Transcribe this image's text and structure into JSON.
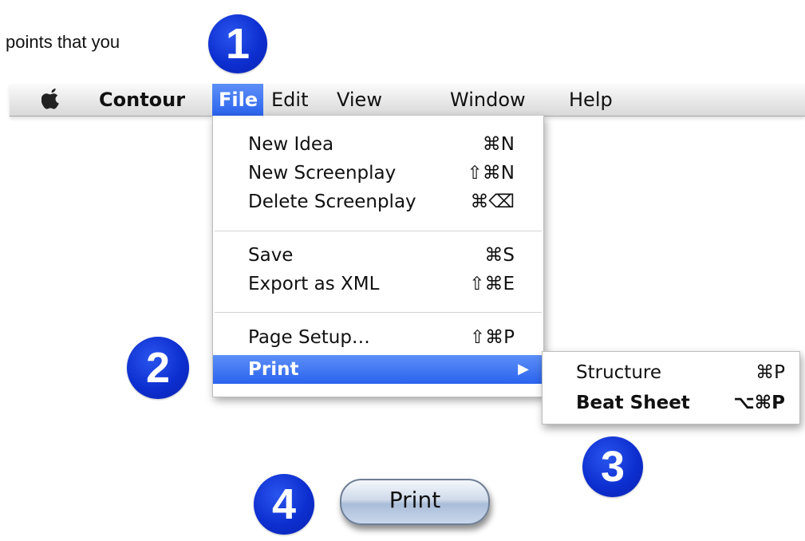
{
  "intro": {
    "text": "points that you"
  },
  "callouts": [
    "1",
    "2",
    "3",
    "4"
  ],
  "menubar": {
    "app": "Contour",
    "items": [
      {
        "label": "File",
        "active": true
      },
      {
        "label": "Edit"
      },
      {
        "label": "View"
      },
      {
        "label": "Window"
      },
      {
        "label": "Help"
      }
    ]
  },
  "file_menu": {
    "items": [
      {
        "label": "New Idea",
        "shortcut": "⌘N"
      },
      {
        "label": "New Screenplay",
        "shortcut": "⇧⌘N"
      },
      {
        "label": "Delete Screenplay",
        "shortcut": "⌘⌫"
      },
      {
        "label": "Save",
        "shortcut": "⌘S"
      },
      {
        "label": "Export as XML",
        "shortcut": "⇧⌘E"
      },
      {
        "label": "Page Setup…",
        "shortcut": "⇧⌘P"
      },
      {
        "label": "Print",
        "shortcut": "▶",
        "highlighted": true
      }
    ]
  },
  "print_submenu": {
    "items": [
      {
        "label": "Structure",
        "shortcut": "⌘P"
      },
      {
        "label": "Beat Sheet",
        "shortcut": "⌥⌘P"
      }
    ]
  },
  "print_button": {
    "label": "Print"
  },
  "colors": {
    "callout": "#0d2fd0",
    "menu_highlight": "#2a63ee"
  },
  "icons": {
    "apple": "apple-logo-icon",
    "submenu_arrow": "submenu-arrow-icon"
  }
}
